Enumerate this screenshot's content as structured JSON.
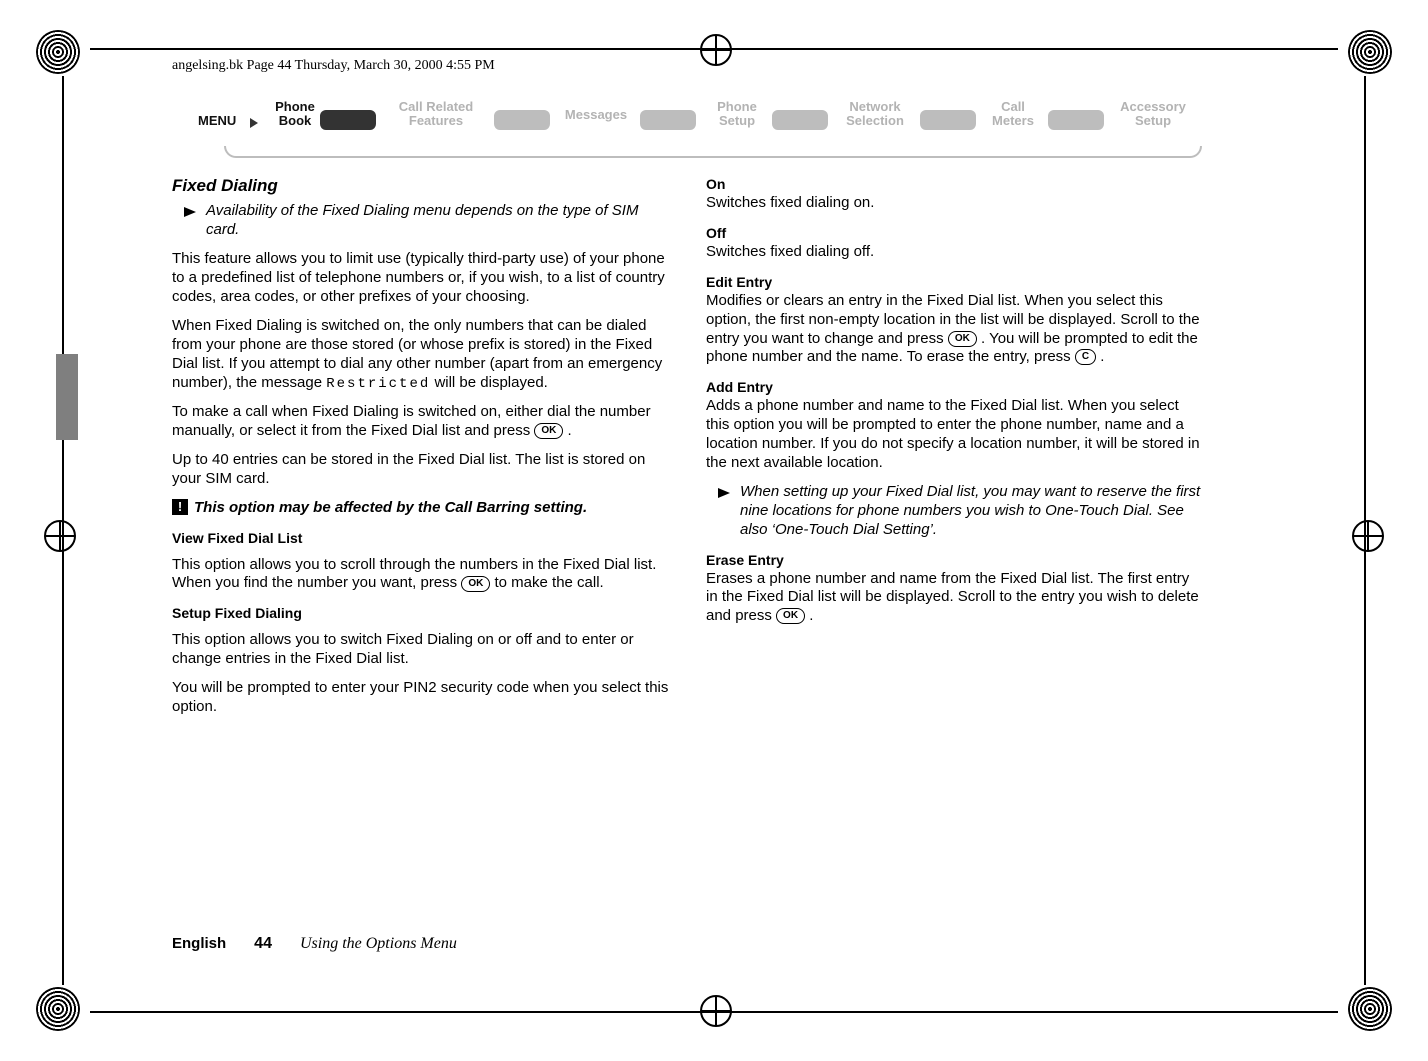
{
  "header_line": "angelsing.bk  Page 44  Thursday, March 30, 2000  4:55 PM",
  "ribbon": {
    "menu": "MENU",
    "items": [
      {
        "l1": "Phone",
        "l2": "Book",
        "active": true
      },
      {
        "l1": "Call Related",
        "l2": "Features",
        "active": false
      },
      {
        "l1": "Messages",
        "l2": "",
        "active": false
      },
      {
        "l1": "Phone",
        "l2": "Setup",
        "active": false
      },
      {
        "l1": "Network",
        "l2": "Selection",
        "active": false
      },
      {
        "l1": "Call",
        "l2": "Meters",
        "active": false
      },
      {
        "l1": "Accessory",
        "l2": "Setup",
        "active": false
      }
    ]
  },
  "left": {
    "title": "Fixed Dialing",
    "note1": "Availability of the Fixed Dialing menu depends on the type of SIM card.",
    "p1": "This feature allows you to limit use (typically third-party use) of your phone to a predefined list of telephone numbers or, if you wish, to a list of country codes, area codes, or other prefixes of your choosing.",
    "p2a": "When Fixed Dialing is switched on, the only numbers that can be dialed from your phone are those stored (or whose prefix is stored) in the Fixed Dial list. If you attempt to dial any other number (apart from an emergency number), the message ",
    "p2_code": "Restricted",
    "p2b": " will be displayed.",
    "p3a": "To make a call when Fixed Dialing is switched on, either dial the number manually, or select it from the Fixed Dial list and press ",
    "p3_btn": "OK",
    "p3b": ".",
    "p4": "Up to 40 entries can be stored in the Fixed Dial list. The list is stored on your SIM card.",
    "warn": "This option may be affected by the Call Barring setting.",
    "sub1": "View Fixed Dial List",
    "p5a": "This option allows you to scroll through the numbers in the Fixed Dial list. When you find the number you want, press ",
    "p5_btn": "OK",
    "p5b": " to make the call.",
    "sub2": "Setup Fixed Dialing",
    "p6": "This option allows you to switch Fixed Dialing on or off and to enter or change entries in the Fixed Dial list.",
    "p7": "You will be prompted to enter your PIN2 security code when you select this option."
  },
  "right": {
    "on_h": "On",
    "on_p": "Switches fixed dialing on.",
    "off_h": "Off",
    "off_p": "Switches fixed dialing off.",
    "edit_h": "Edit Entry",
    "edit_p_a": "Modifies or clears an entry in the Fixed Dial list. When you select this option, the first non-empty location in the list will be displayed. Scroll to the entry you want to change and press ",
    "edit_btn1": "OK",
    "edit_p_b": ". You will be prompted to edit the phone number and the name. To erase the entry, press ",
    "edit_btn2": "C",
    "edit_p_c": ".",
    "add_h": "Add Entry",
    "add_p": "Adds a phone number and name to the Fixed Dial list. When you select this option you will be prompted to enter the phone number, name and a location number. If you do not specify a location number, it will be stored in the next available location.",
    "note2": "When setting up your Fixed Dial list, you may want to reserve the first nine locations for phone numbers you wish to One-Touch Dial. See also ‘One-Touch Dial Setting’.",
    "erase_h": "Erase Entry",
    "erase_p_a": "Erases a phone number and name from the Fixed Dial list. The first entry in the Fixed Dial list will be displayed. Scroll to the entry you wish to delete and press ",
    "erase_btn": "OK",
    "erase_p_b": "."
  },
  "footer": {
    "lang": "English",
    "page": "44",
    "section": "Using the Options Menu"
  },
  "icons": {
    "hand": "pointing-hand-icon",
    "bang": "!"
  }
}
